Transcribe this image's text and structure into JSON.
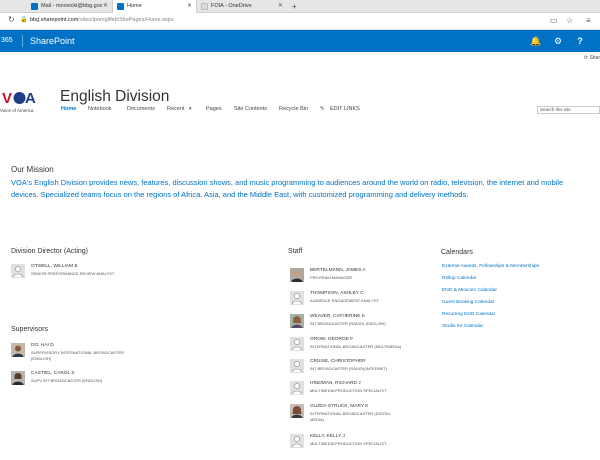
{
  "browser": {
    "tabs": [
      {
        "label": "Mail - mnovicki@bbg.gov",
        "fav_color": "#0072c6"
      },
      {
        "label": "Home",
        "fav_color": "#0072c6"
      },
      {
        "label": "FOIA - OneDrive",
        "fav_color": "#e6e6e6"
      }
    ],
    "new_tab": "+",
    "url_host": "bbg.sharepoint.com",
    "url_path": "/sites/ip/englifeb/SitePages/Home.aspx"
  },
  "suitebar": {
    "app_prefix": "365",
    "title": "SharePoint",
    "bell_icon": "🔔",
    "gear_icon": "⚙",
    "help_icon": "?"
  },
  "share_label": "Shar",
  "site": {
    "logo_sub": "Voice of America",
    "title": "English Division",
    "nav": [
      {
        "label": "Home",
        "active": true
      },
      {
        "label": "Notebook"
      },
      {
        "label": "Documents"
      },
      {
        "label": "Recent"
      },
      {
        "label": "Pages"
      },
      {
        "label": "Site Contents"
      },
      {
        "label": "Recycle Bin"
      },
      {
        "label": "EDIT LINKS"
      }
    ],
    "search_placeholder": "Search this site"
  },
  "mission": {
    "heading": "Our Mission",
    "text": "VOA's English Division provides news, features, discussion shows, and music programming to audiences around the world on radio, television, the internet and mobile devices. Specialized teams focus on the regions of Africa, Asia, and the Middle East, with customized programming and delivery methods."
  },
  "director": {
    "heading": "Division Director (Acting)",
    "people": [
      {
        "name": "OTWELL, WILLIAM E",
        "title": "SENIOR PERFORMANCE REVIEW ANALYST",
        "photo": false
      }
    ]
  },
  "supervisors": {
    "heading": "Supervisors",
    "people": [
      {
        "name": "DO, HAI D",
        "title": "SUPERVISORY INTERNATIONAL BROADCASTER (ENGLISH)",
        "photo": true
      },
      {
        "name": "CASTIEL, CAROL S",
        "title": "SUPV INT BROADCASTER (ENGLISH)",
        "photo": true
      }
    ]
  },
  "staff": {
    "heading": "Staff",
    "people": [
      {
        "name": "BERTELMANN, JAMES A",
        "title": "PROGRAM MANAGER",
        "photo": true
      },
      {
        "name": "THOMPSON, ASHLEY C",
        "title": "AUDIENCE ENGAGEMENT ANALYST",
        "photo": false
      },
      {
        "name": "WEAVER, CATHERINE K",
        "title": "INT BROADCASTER (RADIO) (ENGLISH)",
        "photo": true
      },
      {
        "name": "GROW, GEORGE F",
        "title": "INTERNATIONAL BROADCASTER (MULTIMEDIA)",
        "photo": false
      },
      {
        "name": "CRUISE, CHRISTOPHER",
        "title": "INT BROADCASTER (RADIO)(INTERNET)",
        "photo": false
      },
      {
        "name": "HINDMAN, RICHARD J",
        "title": "MULTIMEDIA PRODUCTION SPECIALIST",
        "photo": false
      },
      {
        "name": "GUZDA STRUCK, MARY K",
        "title": "INTERNATIONAL BROADCASTER (DIGITAL MEDIA)",
        "photo": true
      },
      {
        "name": "KELLY, KELLY J",
        "title": "MULTIMEDIA PRODUCTION SPECIALIST",
        "photo": false
      }
    ]
  },
  "calendars": {
    "heading": "Calendars",
    "links": [
      "External Awards, Fellowships & Memberships",
      "Rollup Calendar",
      "ENG & Minicom Calendar",
      "Guest Booking Calendar",
      "Recurring ENG Calendar",
      "Studio 54 Calendar"
    ]
  },
  "colors": {
    "brand": "#0072c6",
    "voa_red": "#c8102e",
    "voa_blue": "#1f3c88"
  }
}
